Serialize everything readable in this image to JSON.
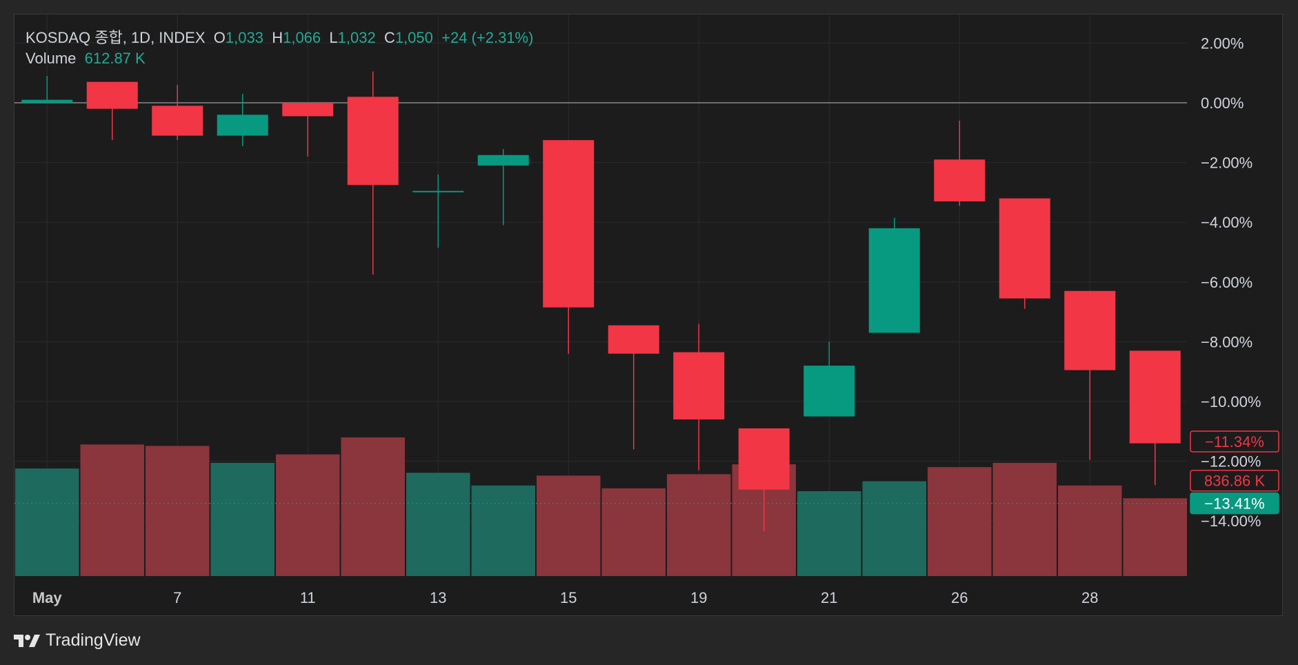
{
  "header": {
    "symbol": "KOSDAQ 종합, 1D, INDEX",
    "o_label": "O",
    "o_value": "1,033",
    "h_label": "H",
    "h_value": "1,066",
    "l_label": "L",
    "l_value": "1,032",
    "c_label": "C",
    "c_value": "1,050",
    "change": "+24 (+2.31%)",
    "volume_label": "Volume",
    "volume_value": "612.87 K"
  },
  "footer": {
    "brand": "TradingView",
    "logo_icon": "tradingview-logo-icon"
  },
  "colors": {
    "up": "#089981",
    "down": "#f23645",
    "up_volume": "#1e6a5e",
    "down_volume": "#8b353c",
    "background": "#1c1c1d",
    "grid": "#2b2b2e",
    "axis_text": "#d1d4dc"
  },
  "chart_data": {
    "type": "candlestick",
    "y_unit": "percent",
    "y_ticks": [
      "2.00%",
      "0.00%",
      "−2.00%",
      "−4.00%",
      "−6.00%",
      "−8.00%",
      "−10.00%",
      "−12.00%",
      "−14.00%"
    ],
    "y_tick_values": [
      2,
      0,
      -2,
      -4,
      -6,
      -8,
      -10,
      -12,
      -14
    ],
    "ylim": [
      -15.5,
      3.0
    ],
    "x_ticks": [
      {
        "label": "May",
        "index": 0,
        "bold": true
      },
      {
        "label": "7",
        "index": 2
      },
      {
        "label": "11",
        "index": 4
      },
      {
        "label": "13",
        "index": 6
      },
      {
        "label": "15",
        "index": 8
      },
      {
        "label": "19",
        "index": 10
      },
      {
        "label": "21",
        "index": 12
      },
      {
        "label": "26",
        "index": 14
      },
      {
        "label": "28",
        "index": 16
      }
    ],
    "candles": [
      {
        "open": 0.0,
        "high": 0.9,
        "low": 0.0,
        "close": 0.1
      },
      {
        "open": 0.7,
        "high": 0.7,
        "low": -1.25,
        "close": -0.2
      },
      {
        "open": -0.1,
        "high": 0.6,
        "low": -1.25,
        "close": -1.1
      },
      {
        "open": -1.1,
        "high": 0.3,
        "low": -1.45,
        "close": -0.4
      },
      {
        "open": 0.0,
        "high": 0.0,
        "low": -1.8,
        "close": -0.45
      },
      {
        "open": 0.2,
        "high": 1.05,
        "low": -5.75,
        "close": -2.75
      },
      {
        "open": -2.95,
        "high": -2.4,
        "low": -4.85,
        "close": -2.95
      },
      {
        "open": -2.1,
        "high": -1.55,
        "low": -4.1,
        "close": -1.75
      },
      {
        "open": -1.25,
        "high": -1.25,
        "low": -8.4,
        "close": -6.85
      },
      {
        "open": -7.45,
        "high": -7.45,
        "low": -11.6,
        "close": -8.4
      },
      {
        "open": -8.35,
        "high": -7.4,
        "low": -12.3,
        "close": -10.6
      },
      {
        "open": -10.9,
        "high": -10.9,
        "low": -14.35,
        "close": -12.95
      },
      {
        "open": -10.5,
        "high": -8.0,
        "low": -10.5,
        "close": -8.8
      },
      {
        "open": -7.7,
        "high": -3.85,
        "low": -7.7,
        "close": -4.2
      },
      {
        "open": -1.9,
        "high": -0.6,
        "low": -3.45,
        "close": -3.3
      },
      {
        "open": -3.2,
        "high": -3.2,
        "low": -6.9,
        "close": -6.55
      },
      {
        "open": -6.3,
        "high": -6.3,
        "low": -11.95,
        "close": -8.95
      },
      {
        "open": -8.3,
        "high": -8.3,
        "low": -12.8,
        "close": -11.4
      }
    ],
    "volume": {
      "relative": [
        0.76,
        0.93,
        0.92,
        0.8,
        0.86,
        0.98,
        0.73,
        0.64,
        0.71,
        0.62,
        0.72,
        0.79,
        0.6,
        0.67,
        0.77,
        0.8,
        0.64,
        0.55
      ],
      "direction": [
        "up",
        "down",
        "down",
        "up",
        "down",
        "down",
        "up",
        "up",
        "down",
        "down",
        "down",
        "down",
        "up",
        "up",
        "down",
        "down",
        "down",
        "down"
      ]
    },
    "price_labels": [
      {
        "text": "−11.34%",
        "value": -11.34,
        "style": "down-outline"
      },
      {
        "text": "836.86 K",
        "value": -12.65,
        "style": "down-outline"
      },
      {
        "text": "−13.41%",
        "value": -13.41,
        "style": "up-fill",
        "dotted_line": true
      }
    ],
    "zero_line": 0.0
  }
}
